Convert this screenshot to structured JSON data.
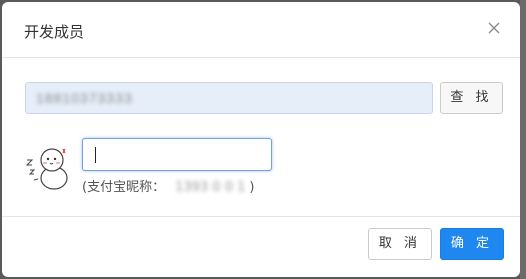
{
  "dialog": {
    "title": "开发成员",
    "close_icon": "close-icon"
  },
  "search": {
    "value": "18810373333",
    "button_label": "查 找"
  },
  "result": {
    "avatar_icon": "snowman-sticker-avatar",
    "nickname_prefix": "(支付宝昵称：",
    "nickname_value": "1393 0 0 1",
    "nickname_suffix": ")"
  },
  "footer": {
    "cancel_label": "取 消",
    "confirm_label": "确 定"
  },
  "colors": {
    "accent": "#1e88f0",
    "search_bg": "#e6eefa",
    "focus_border": "#6fa3e0"
  }
}
